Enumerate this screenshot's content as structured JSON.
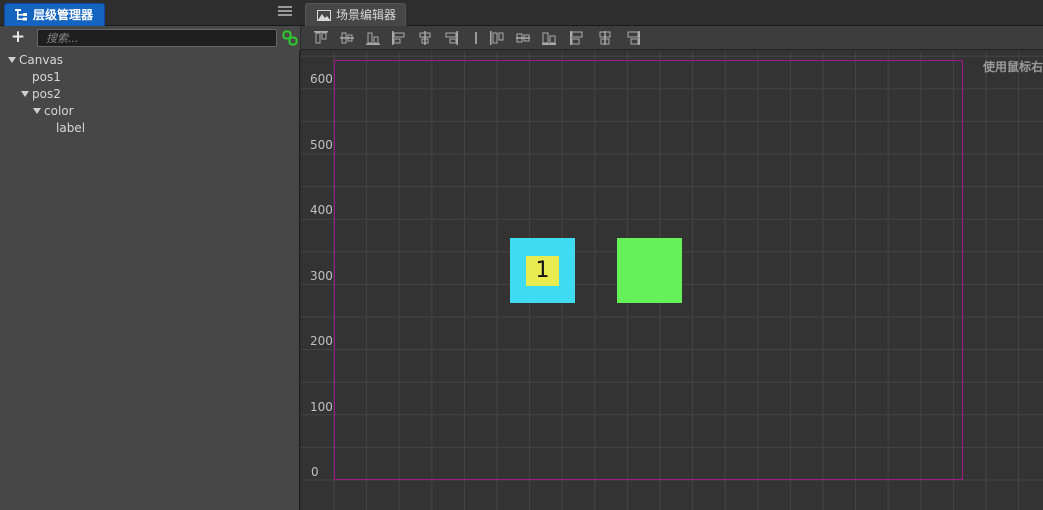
{
  "hierarchy_panel": {
    "tab_label": "层级管理器",
    "search_placeholder": "搜索...",
    "add_label": "+",
    "tree": [
      {
        "label": "Canvas",
        "expanded": true,
        "depth": 0
      },
      {
        "label": "pos1",
        "expanded": false,
        "depth": 1
      },
      {
        "label": "pos2",
        "expanded": true,
        "depth": 1
      },
      {
        "label": "color",
        "expanded": true,
        "depth": 2
      },
      {
        "label": "label",
        "expanded": false,
        "depth": 3
      }
    ]
  },
  "scene_panel": {
    "tab_label": "场景编辑器",
    "hint": "使用鼠标右",
    "y_axis_labels": [
      "600",
      "500",
      "400",
      "300",
      "200",
      "100",
      "0"
    ],
    "label_text": "1",
    "colors": {
      "pos1": "#3edcf0",
      "label_bg": "#e8ec50",
      "pos2": "#66f15a",
      "canvas_border": "#9c1a8c",
      "tab_active": "#1565c0"
    },
    "align_tools": [
      "align-top-icon",
      "align-vcenter-icon",
      "align-bottom-icon",
      "align-left-icon",
      "align-hcenter-icon",
      "align-right-icon",
      "distribute-top-icon",
      "distribute-vcenter-icon",
      "distribute-bottom-icon",
      "distribute-left-icon",
      "distribute-hcenter-icon",
      "distribute-right-icon"
    ]
  }
}
